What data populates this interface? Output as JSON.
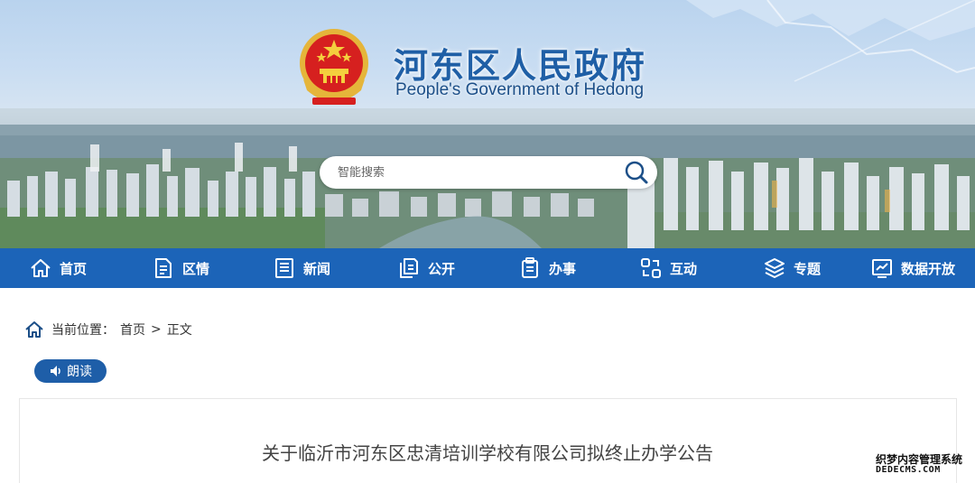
{
  "header": {
    "title": "河东区人民政府",
    "subtitle": "People's Government of Hedong",
    "emblem_icon": "national-emblem-icon"
  },
  "search": {
    "placeholder": "智能搜索",
    "icon": "search-icon"
  },
  "nav": {
    "background": "#1c64b8",
    "items": [
      {
        "label": "首页",
        "icon": "home-icon"
      },
      {
        "label": "区情",
        "icon": "document-icon"
      },
      {
        "label": "新闻",
        "icon": "newspaper-icon"
      },
      {
        "label": "公开",
        "icon": "files-icon"
      },
      {
        "label": "办事",
        "icon": "clipboard-icon"
      },
      {
        "label": "互动",
        "icon": "interaction-icon"
      },
      {
        "label": "专题",
        "icon": "layers-icon"
      },
      {
        "label": "数据开放",
        "icon": "data-icon"
      }
    ]
  },
  "breadcrumb": {
    "prefix": "当前位置：",
    "items": [
      "首页",
      "正文"
    ],
    "separator": ">"
  },
  "read_aloud": {
    "label": "朗读",
    "icon": "speaker-icon"
  },
  "article": {
    "title": "关于临沂市河东区忠清培训学校有限公司拟终止办学公告"
  },
  "watermark": {
    "line1": "织梦内容管理系统",
    "line2": "DEDECMS.COM"
  }
}
